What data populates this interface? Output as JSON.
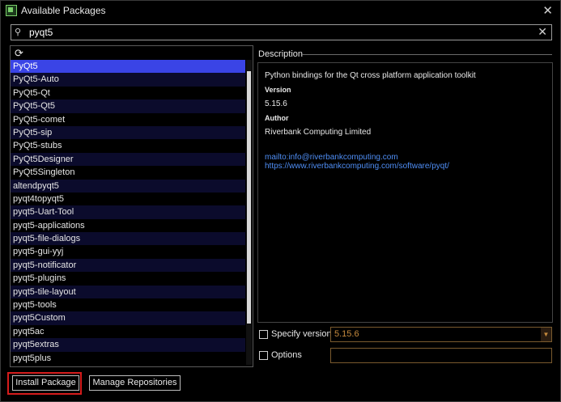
{
  "window": {
    "title": "Available Packages",
    "close_glyph": "✕",
    "icon_name": "app-icon"
  },
  "search": {
    "icon_glyph": "⚲",
    "value": "pyqt5",
    "clear_glyph": "✕"
  },
  "list": {
    "refresh_glyph": "⟳",
    "selected_index": 0,
    "items": [
      "PyQt5",
      "PyQt5-Auto",
      "PyQt5-Qt",
      "PyQt5-Qt5",
      "PyQt5-comet",
      "PyQt5-sip",
      "PyQt5-stubs",
      "PyQt5Designer",
      "PyQt5Singleton",
      "altendpyqt5",
      "pyqt4topyqt5",
      "pyqt5-Uart-Tool",
      "pyqt5-applications",
      "pyqt5-file-dialogs",
      "pyqt5-gui-yyj",
      "pyqt5-notificator",
      "pyqt5-plugins",
      "pyqt5-tile-layout",
      "pyqt5-tools",
      "pyqt5Custom",
      "pyqt5ac",
      "pyqt5extras",
      "pyqt5plus"
    ]
  },
  "description": {
    "section_label": "Description",
    "summary": "Python bindings for the Qt cross platform application toolkit",
    "version_heading": "Version",
    "version_value": "5.15.6",
    "author_heading": "Author",
    "author_value": "Riverbank Computing Limited",
    "mailto_link": "mailto:info@riverbankcomputing.com",
    "homepage_link": "https://www.riverbankcomputing.com/software/pyqt/"
  },
  "options": {
    "specify_version_label": "Specify version",
    "specify_version_checked": false,
    "version_combo_value": "5.15.6",
    "options_label": "Options",
    "options_checked": false,
    "options_value": ""
  },
  "buttons": {
    "install_label": "Install Package",
    "manage_repos_label": "Manage Repositories"
  }
}
